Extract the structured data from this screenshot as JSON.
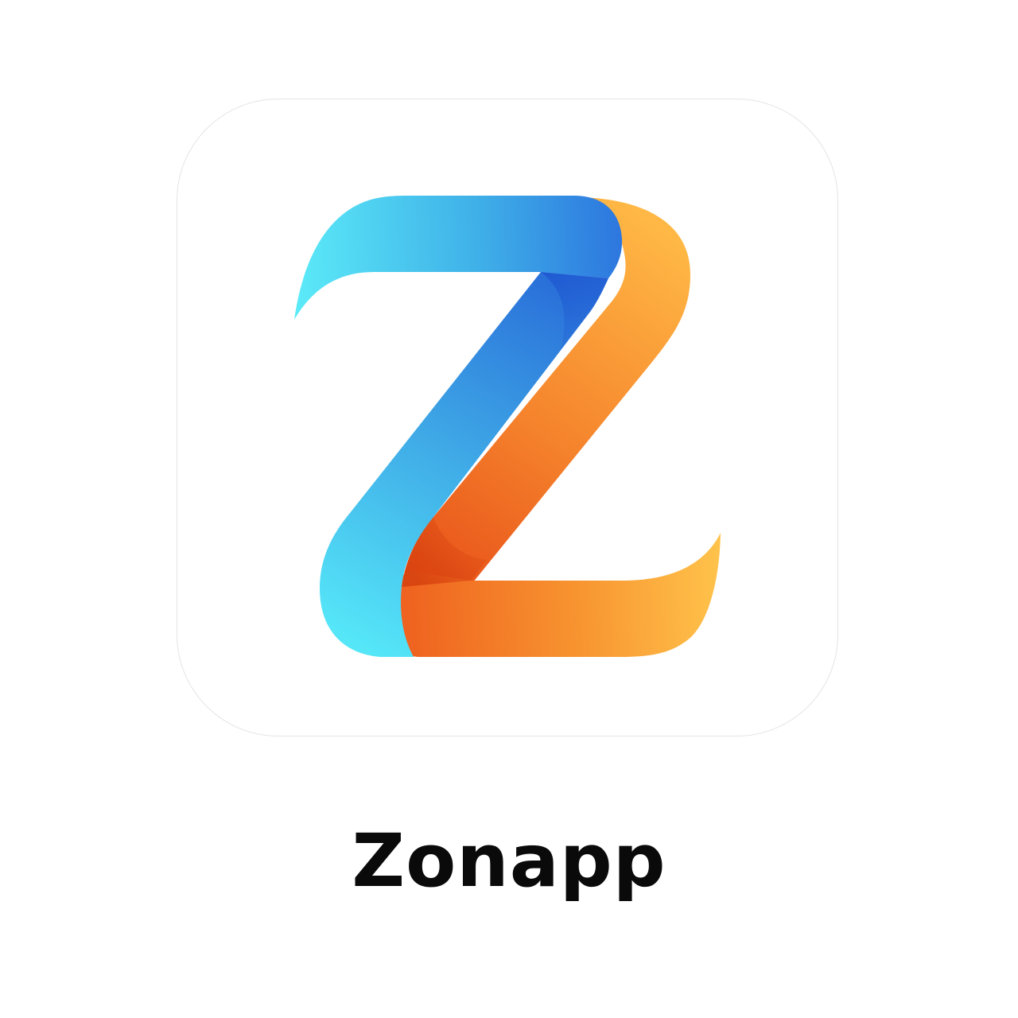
{
  "app": {
    "name": "Zonapp"
  },
  "logo": {
    "icon": "z-logo-icon",
    "colors": {
      "blue_light": "#5BEAF8",
      "blue_mid": "#3FA6E6",
      "blue_dark": "#2A6FDD",
      "orange_dark": "#EE5A1C",
      "orange_mid": "#F5862E",
      "orange_light": "#FFC24A"
    }
  }
}
